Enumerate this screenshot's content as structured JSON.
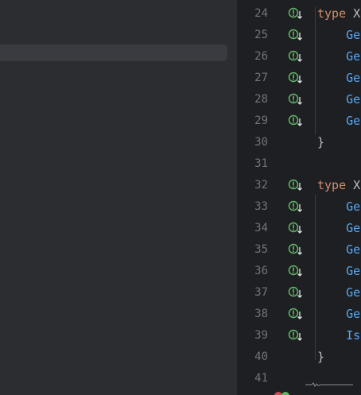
{
  "editor": {
    "lines": [
      {
        "num": "24",
        "marker": true,
        "tokens": [
          {
            "cls": "kw",
            "text": "type "
          },
          {
            "cls": "br",
            "text": "X"
          }
        ]
      },
      {
        "num": "25",
        "marker": true,
        "tokens": [
          {
            "cls": "fn",
            "text": "    Ge"
          }
        ]
      },
      {
        "num": "26",
        "marker": true,
        "tokens": [
          {
            "cls": "fn",
            "text": "    Ge"
          }
        ]
      },
      {
        "num": "27",
        "marker": true,
        "tokens": [
          {
            "cls": "fn",
            "text": "    Ge"
          }
        ]
      },
      {
        "num": "28",
        "marker": true,
        "tokens": [
          {
            "cls": "fn",
            "text": "    Ge"
          }
        ]
      },
      {
        "num": "29",
        "marker": true,
        "tokens": [
          {
            "cls": "fn",
            "text": "    Ge"
          }
        ]
      },
      {
        "num": "30",
        "marker": false,
        "tokens": [
          {
            "cls": "br",
            "text": "}"
          }
        ]
      },
      {
        "num": "31",
        "marker": false,
        "tokens": []
      },
      {
        "num": "32",
        "marker": true,
        "tokens": [
          {
            "cls": "kw",
            "text": "type "
          },
          {
            "cls": "br",
            "text": "X"
          }
        ]
      },
      {
        "num": "33",
        "marker": true,
        "tokens": [
          {
            "cls": "fn",
            "text": "    Ge"
          }
        ]
      },
      {
        "num": "34",
        "marker": true,
        "tokens": [
          {
            "cls": "fn",
            "text": "    Ge"
          }
        ]
      },
      {
        "num": "35",
        "marker": true,
        "tokens": [
          {
            "cls": "fn",
            "text": "    Ge"
          }
        ]
      },
      {
        "num": "36",
        "marker": true,
        "tokens": [
          {
            "cls": "fn",
            "text": "    Ge"
          }
        ]
      },
      {
        "num": "37",
        "marker": true,
        "tokens": [
          {
            "cls": "fn",
            "text": "    Ge"
          }
        ]
      },
      {
        "num": "38",
        "marker": true,
        "tokens": [
          {
            "cls": "fn",
            "text": "    Ge"
          }
        ]
      },
      {
        "num": "39",
        "marker": true,
        "tokens": [
          {
            "cls": "fn",
            "text": "    Is"
          }
        ]
      },
      {
        "num": "40",
        "marker": false,
        "tokens": [
          {
            "cls": "br",
            "text": "}"
          }
        ]
      },
      {
        "num": "41",
        "marker": false,
        "tokens": []
      }
    ],
    "gutter_icon": "implemented-interface-down-arrow-icon"
  },
  "colors": {
    "background": "#2b2d30",
    "editor_background": "#1e1f22",
    "keyword": "#cf8e6d",
    "function": "#56a8f5",
    "brace": "#bcbec4",
    "line_number": "#6f737a",
    "gutter_icon": "#5fb865"
  }
}
